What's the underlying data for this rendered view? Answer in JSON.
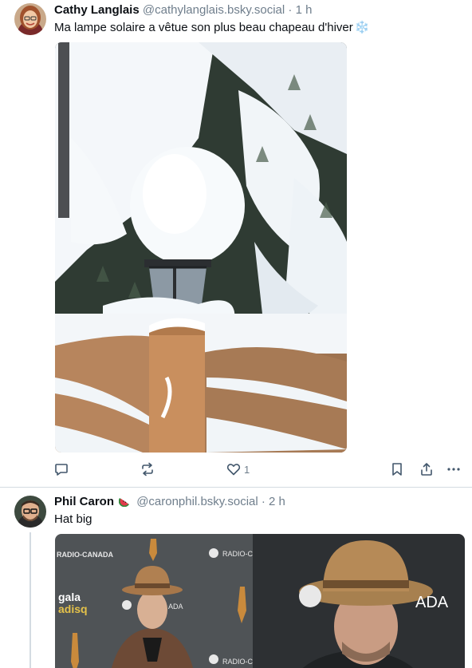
{
  "posts": [
    {
      "author_name": "Cathy Langlais",
      "handle": "@cathylanglais.bsky.social",
      "separator": "·",
      "time": "1 h",
      "text": "Ma lampe solaire a vêtue son plus beau chapeau d'hiver",
      "text_emoji": "❄️",
      "avatar_icon": "avatar-photo-woman",
      "image_description_icon": "snow-covered-solar-lamp-photo",
      "actions": {
        "reply_icon": "reply-icon",
        "repost_icon": "repost-icon",
        "like_icon": "heart-icon",
        "like_count": "1",
        "bookmark_icon": "bookmark-icon",
        "share_icon": "share-icon",
        "more_icon": "more-icon"
      }
    },
    {
      "author_name": "Phil Caron",
      "author_emoji": "watermelon",
      "handle": "@caronphil.bsky.social",
      "separator": "·",
      "time": "2 h",
      "text": "Hat big",
      "avatar_icon": "avatar-photo-man",
      "image_texts": {
        "left_logo_top": "RADIO-CANADA",
        "gala_line1": "gala",
        "gala_line2": "adisq",
        "radio_c_1": "RADIO-C",
        "aada": "ADA",
        "radio_c_2": "RADIO-C",
        "right_ada": "ADA"
      }
    }
  ],
  "colors": {
    "text_primary": "#0b0f14",
    "text_secondary": "#6f7e8c",
    "divider": "#d4dbe2",
    "icon": "#42576c",
    "snow_emoji": "#6ab8e8"
  }
}
